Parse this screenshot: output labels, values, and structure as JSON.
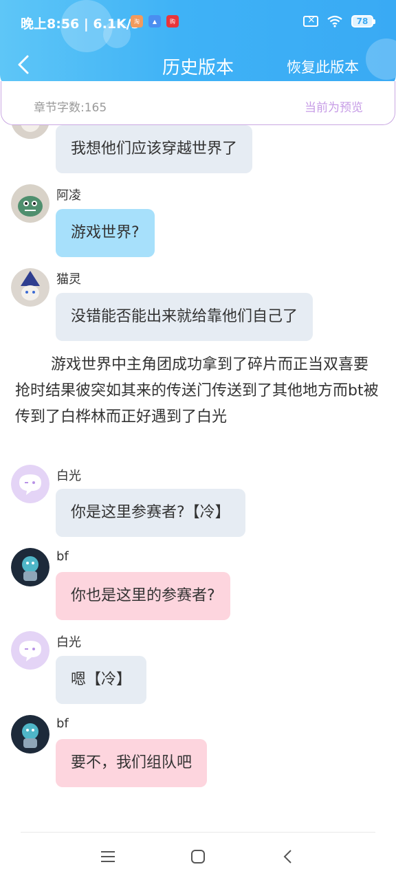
{
  "status_bar": {
    "time": "晚上8:56 | 6.1K/s",
    "battery": "78"
  },
  "nav": {
    "title": "历史版本",
    "restore_label": "恢复此版本"
  },
  "info": {
    "word_count": "章节字数:165",
    "preview_label": "当前为预览"
  },
  "messages": [
    {
      "sender": "",
      "text": "我想他们应该穿越世界了",
      "style": "gray",
      "avatar": "cat-witch-avatar"
    },
    {
      "sender": "阿凌",
      "text": "游戏世界?",
      "style": "blue",
      "avatar": "green-monster-avatar"
    },
    {
      "sender": "猫灵",
      "text": "没错能否能出来就给靠他们自己了",
      "style": "gray",
      "avatar": "cat-witch-avatar"
    }
  ],
  "narration": "游戏世界中主角团成功拿到了碎片而正当双喜要抢时结果彼突如其来的传送门传送到了其他地方而bt被传到了白桦林而正好遇到了白光",
  "messages2": [
    {
      "sender": "白光",
      "text": "你是这里参赛者?【冷】",
      "style": "gray",
      "avatar": "default-chat-avatar"
    },
    {
      "sender": "bf",
      "text": "你也是这里的参赛者?",
      "style": "pink",
      "avatar": "bf-avatar"
    },
    {
      "sender": "白光",
      "text": "嗯【冷】",
      "style": "gray",
      "avatar": "default-chat-avatar"
    },
    {
      "sender": "bf",
      "text": "要不，我们组队吧",
      "style": "pink",
      "avatar": "bf-avatar"
    }
  ],
  "colors": {
    "header_blue": "#3fb2f6",
    "bubble_gray": "#e6ecf3",
    "bubble_blue": "#a7e0fb",
    "bubble_pink": "#fdd5de",
    "preview_purple": "#c69be6"
  }
}
